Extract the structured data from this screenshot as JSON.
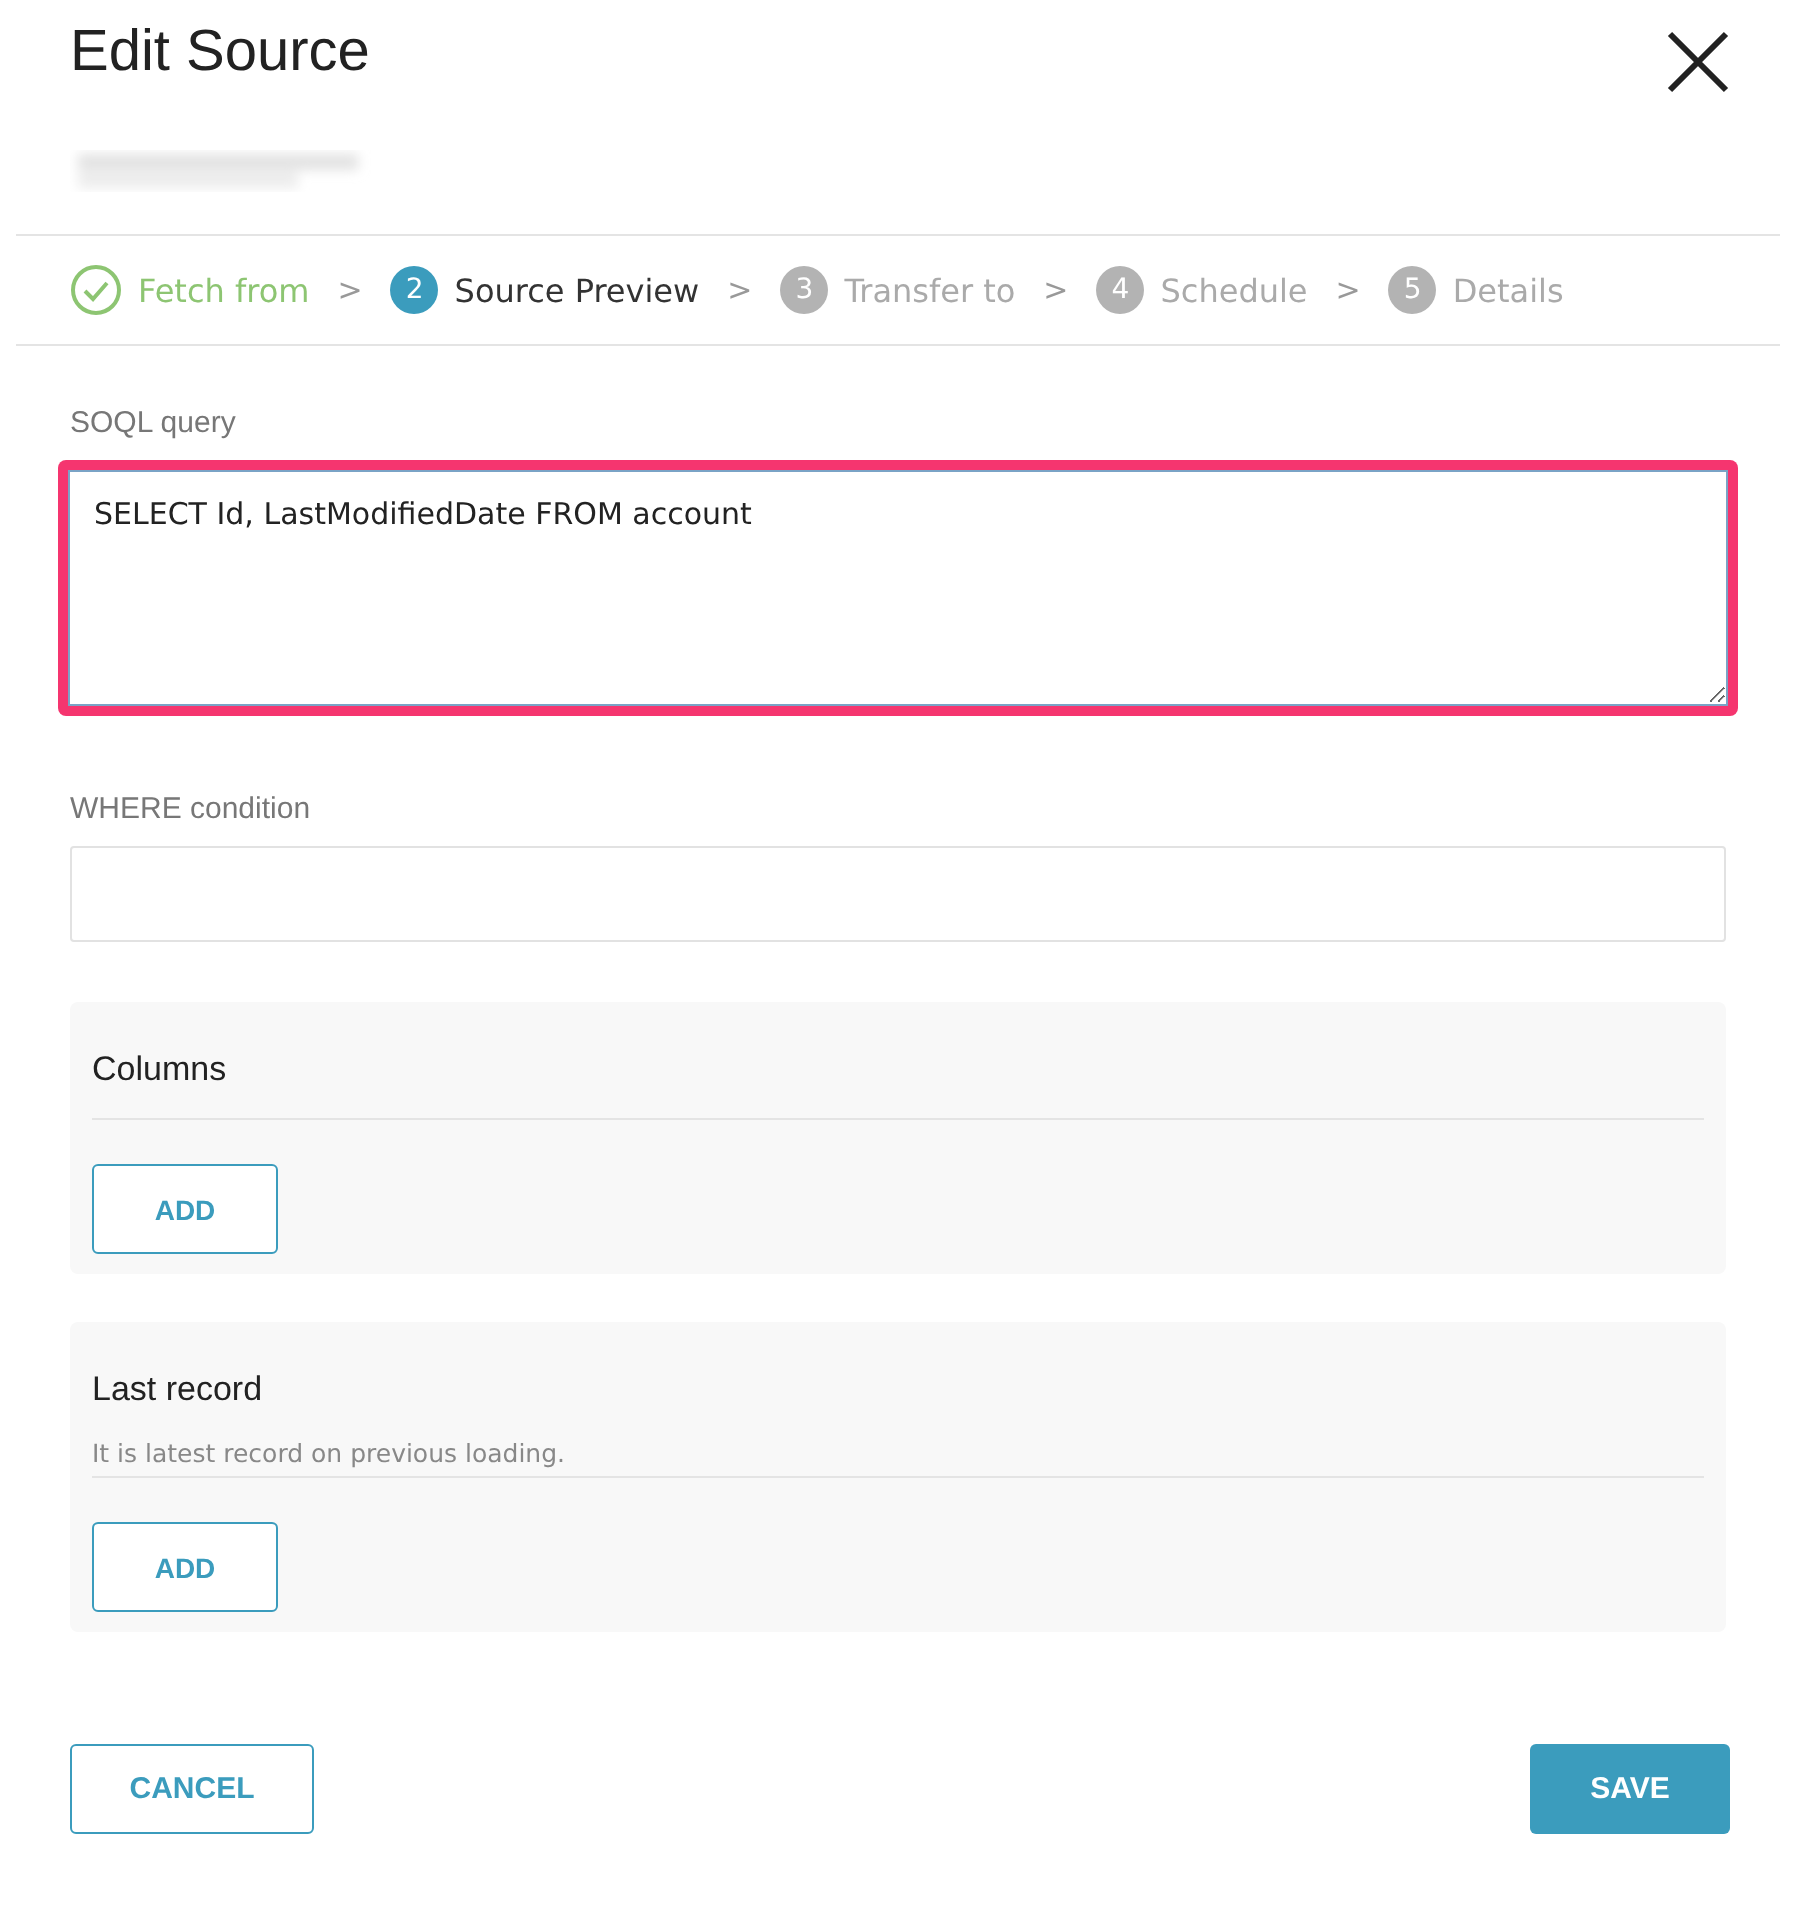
{
  "dialog": {
    "title": "Edit Source"
  },
  "steps": [
    {
      "kind": "done",
      "label": "Fetch from",
      "separator": ">"
    },
    {
      "kind": "current",
      "number": "2",
      "label": "Source Preview",
      "separator": ">"
    },
    {
      "kind": "pending",
      "number": "3",
      "label": "Transfer to",
      "separator": ">"
    },
    {
      "kind": "pending",
      "number": "4",
      "label": "Schedule",
      "separator": ">"
    },
    {
      "kind": "pending",
      "number": "5",
      "label": "Details"
    }
  ],
  "query": {
    "label": "SOQL query",
    "value": "SELECT Id, LastModifiedDate FROM account",
    "highlighted": true
  },
  "where": {
    "label": "WHERE condition"
  },
  "sections": [
    {
      "title": "Columns",
      "button": "ADD"
    },
    {
      "title": "Last record",
      "description": "It is latest record on previous loading.",
      "button": "ADD"
    }
  ],
  "footer": {
    "cancel": "CANCEL",
    "save": "SAVE"
  }
}
